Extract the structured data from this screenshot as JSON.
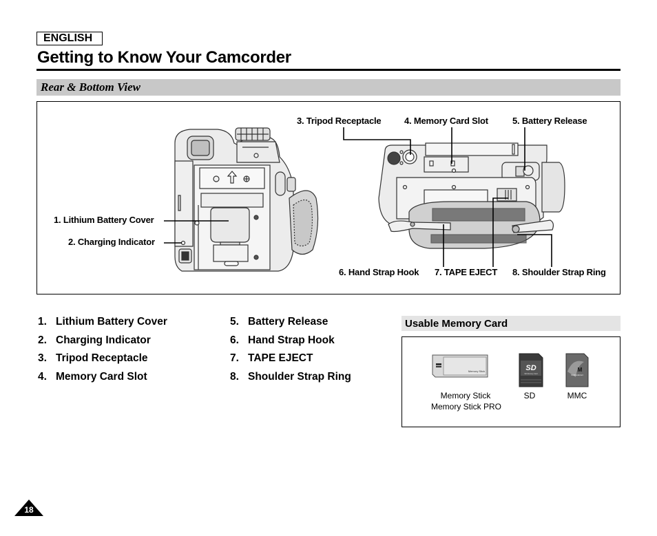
{
  "header": {
    "language": "ENGLISH",
    "title": "Getting to Know Your Camcorder"
  },
  "section": {
    "title": "Rear & Bottom View"
  },
  "figure": {
    "callouts": [
      {
        "id": 1,
        "label": "1. Lithium Battery Cover"
      },
      {
        "id": 2,
        "label": "2. Charging Indicator"
      },
      {
        "id": 3,
        "label": "3. Tripod Receptacle"
      },
      {
        "id": 4,
        "label": "4. Memory Card Slot"
      },
      {
        "id": 5,
        "label": "5. Battery Release"
      },
      {
        "id": 6,
        "label": "6. Hand Strap Hook"
      },
      {
        "id": 7,
        "label": "7. TAPE EJECT"
      },
      {
        "id": 8,
        "label": "8. Shoulder Strap Ring"
      }
    ]
  },
  "legend": {
    "items": [
      {
        "num": "1.",
        "label": "Lithium Battery Cover"
      },
      {
        "num": "2.",
        "label": "Charging Indicator"
      },
      {
        "num": "3.",
        "label": "Tripod Receptacle"
      },
      {
        "num": "4.",
        "label": "Memory Card Slot"
      },
      {
        "num": "5.",
        "label": "Battery Release"
      },
      {
        "num": "6.",
        "label": "Hand Strap Hook"
      },
      {
        "num": "7.",
        "label": "TAPE EJECT"
      },
      {
        "num": "8.",
        "label": "Shoulder Strap Ring"
      }
    ]
  },
  "memory_cards": {
    "title": "Usable Memory Card",
    "cards": [
      {
        "name": "memory-stick",
        "label_line1": "Memory Stick",
        "label_line2": "Memory Stick PRO",
        "image_text": "Memory Stick"
      },
      {
        "name": "sd",
        "label_line1": "SD",
        "image_text": "SD",
        "image_subtext": "SD Memory Card"
      },
      {
        "name": "mmc",
        "label_line1": "MMC",
        "image_text": "M",
        "image_subtext": "MultiMediaCard"
      }
    ]
  },
  "footer": {
    "page_number": "18"
  }
}
